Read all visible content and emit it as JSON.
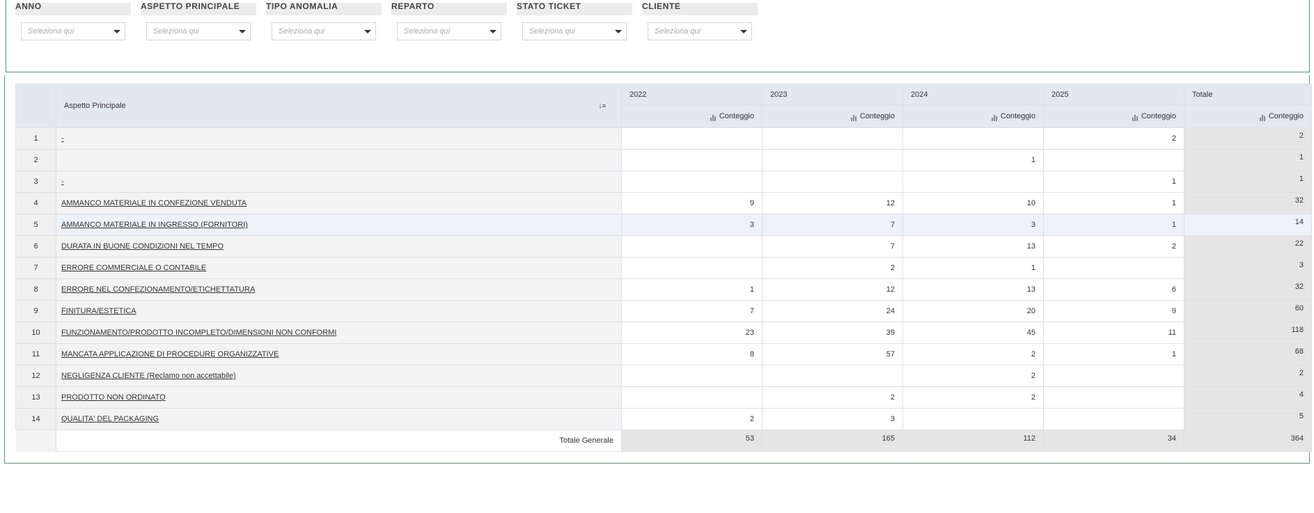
{
  "filters": [
    {
      "label": "ANNO",
      "placeholder": "Seleziona qui"
    },
    {
      "label": "ASPETTO PRINCIPALE",
      "placeholder": "Seleziona qui"
    },
    {
      "label": "TIPO ANOMALIA",
      "placeholder": "Seleziona qui"
    },
    {
      "label": "REPARTO",
      "placeholder": "Seleziona qui"
    },
    {
      "label": "STATO TICKET",
      "placeholder": "Seleziona qui"
    },
    {
      "label": "CLIENTE",
      "placeholder": "Seleziona qui"
    }
  ],
  "pivot": {
    "row_header": "Aspetto Principale",
    "columns": [
      "2022",
      "2023",
      "2024",
      "2025",
      "Totale"
    ],
    "measure": "Conteggio",
    "rows": [
      {
        "num": "1",
        "label": "-",
        "values": [
          "",
          "",
          "",
          "2"
        ],
        "total": "2"
      },
      {
        "num": "2",
        "label": "",
        "values": [
          "",
          "",
          "1",
          ""
        ],
        "total": "1"
      },
      {
        "num": "3",
        "label": "-",
        "values": [
          "",
          "",
          "",
          "1"
        ],
        "total": "1"
      },
      {
        "num": "4",
        "label": "AMMANCO MATERIALE IN CONFEZIONE VENDUTA",
        "values": [
          "9",
          "12",
          "10",
          "1"
        ],
        "total": "32"
      },
      {
        "num": "5",
        "label": "AMMANCO MATERIALE IN INGRESSO (FORNITORI)",
        "values": [
          "3",
          "7",
          "3",
          "1"
        ],
        "total": "14"
      },
      {
        "num": "6",
        "label": "DURATA IN BUONE CONDIZIONI NEL TEMPO",
        "values": [
          "",
          "7",
          "13",
          "2"
        ],
        "total": "22"
      },
      {
        "num": "7",
        "label": "ERRORE COMMERCIALE O CONTABILE",
        "values": [
          "",
          "2",
          "1",
          ""
        ],
        "total": "3"
      },
      {
        "num": "8",
        "label": "ERRORE NEL CONFEZIONAMENTO/ETICHETTATURA",
        "values": [
          "1",
          "12",
          "13",
          "6"
        ],
        "total": "32"
      },
      {
        "num": "9",
        "label": "FINITURA/ESTETICA",
        "values": [
          "7",
          "24",
          "20",
          "9"
        ],
        "total": "60"
      },
      {
        "num": "10",
        "label": "FUNZIONAMENTO/PRODOTTO INCOMPLETO/DIMENSIONI NON CONFORMI",
        "values": [
          "23",
          "39",
          "45",
          "11"
        ],
        "total": "118"
      },
      {
        "num": "11",
        "label": "MANCATA APPLICAZIONE DI PROCEDURE ORGANIZZATIVE",
        "values": [
          "8",
          "57",
          "2",
          "1"
        ],
        "total": "68"
      },
      {
        "num": "12",
        "label": "NEGLIGENZA CLIENTE (Reclamo non accettabile)",
        "values": [
          "",
          "",
          "2",
          ""
        ],
        "total": "2"
      },
      {
        "num": "13",
        "label": "PRODOTTO NON ORDINATO",
        "values": [
          "",
          "2",
          "2",
          ""
        ],
        "total": "4"
      },
      {
        "num": "14",
        "label": "QUALITA' DEL PACKAGING",
        "values": [
          "2",
          "3",
          "",
          ""
        ],
        "total": "5"
      }
    ],
    "grand_total": {
      "label": "Totale Generale",
      "values": [
        "53",
        "165",
        "112",
        "34"
      ],
      "total": "364"
    }
  },
  "icons": {
    "sort": "sort-icon",
    "measure": "bar-chart-icon",
    "dropdown": "chevron-down-icon"
  }
}
